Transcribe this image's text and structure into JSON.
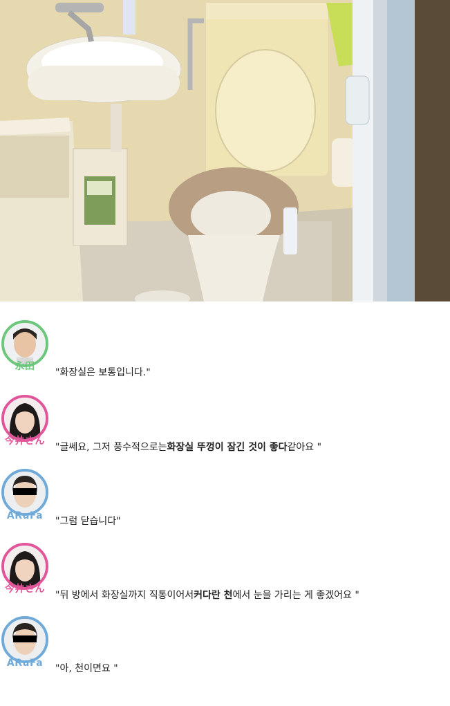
{
  "photo": {
    "description_colors": {
      "wall": "#e8dcb6",
      "floor": "#d9d3c2",
      "door_frame": "#b7c8d6"
    }
  },
  "dialogue": [
    {
      "speaker": "永田",
      "ring_color": "#6cc67b",
      "name_color": "#6cc67b",
      "parts": [
        {
          "text": "\"화장실은 보통입니다.\"",
          "bold": false
        }
      ]
    },
    {
      "speaker": "今井さん",
      "ring_color": "#e2559a",
      "name_color": "#e2559a",
      "parts": [
        {
          "text": "\"글쎄요, 그저 풍수적으로는",
          "bold": false
        },
        {
          "text": "화장실 뚜껑이 잠긴 것이 좋다",
          "bold": true
        },
        {
          "text": "같아요 \"",
          "bold": false
        }
      ]
    },
    {
      "speaker": "ARuFa",
      "ring_color": "#6faad8",
      "name_color": "#6faad8",
      "parts": [
        {
          "text": "\"그럼 닫습니다\"",
          "bold": false
        }
      ]
    },
    {
      "speaker": "今井さん",
      "ring_color": "#e2559a",
      "name_color": "#e2559a",
      "parts": [
        {
          "text": "\"뒤 방에서 화장실까지 직통이어서",
          "bold": false
        },
        {
          "text": "커다란 천",
          "bold": true
        },
        {
          "text": "에서 눈을 가리는 게 좋겠어요 \"",
          "bold": false
        }
      ]
    },
    {
      "speaker": "ARuFa",
      "ring_color": "#6faad8",
      "name_color": "#6faad8",
      "parts": [
        {
          "text": "\"아, 천이면요 \"",
          "bold": false
        }
      ]
    }
  ]
}
